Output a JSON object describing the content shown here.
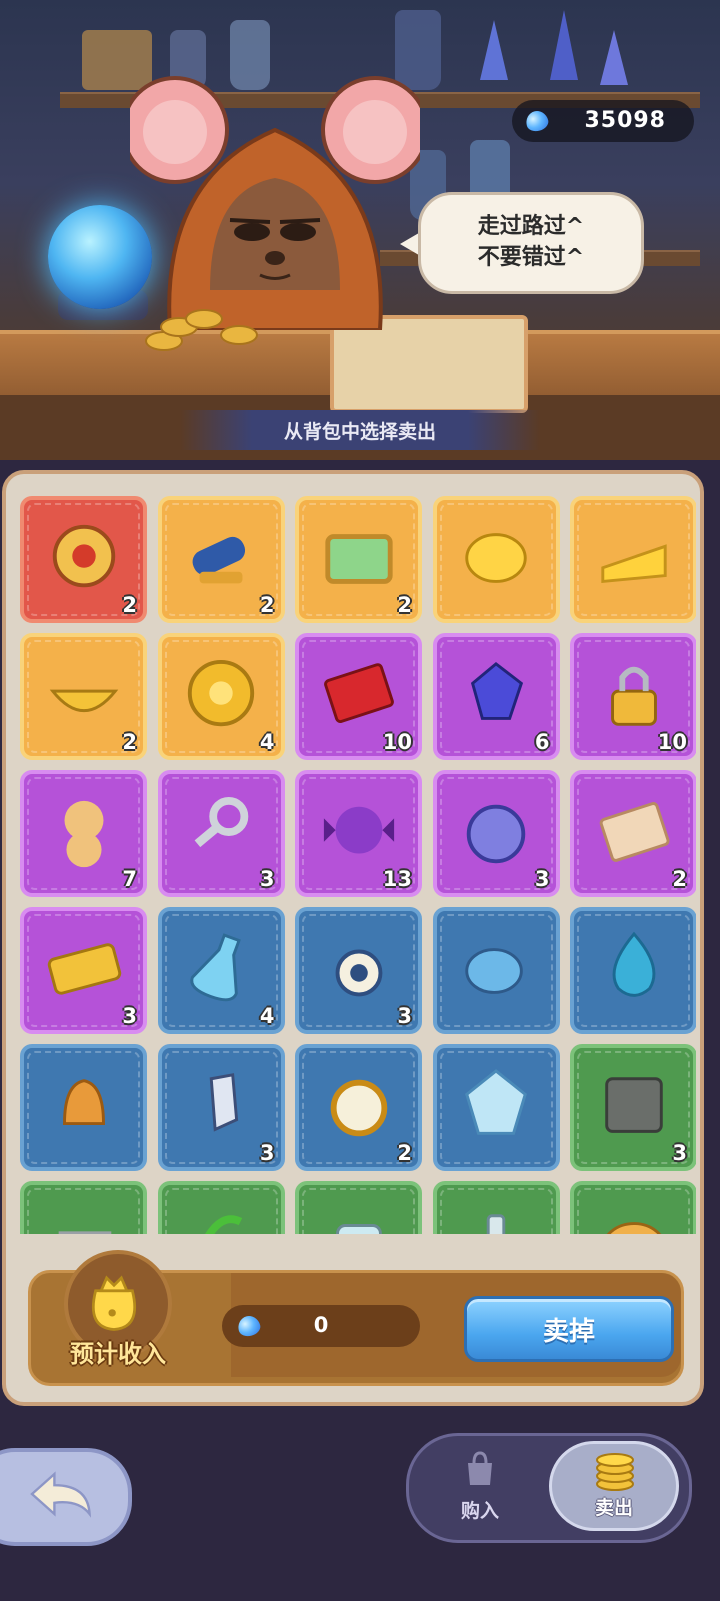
{
  "header": {
    "currency_value": "35098",
    "currency_icon": "blue-gem-icon",
    "speech_line1": "走过路过^",
    "speech_line2": "不要错过^",
    "banner": "从背包中选择卖出"
  },
  "inventory": [
    {
      "rarity": "red",
      "icon": "spinning-wheel-icon",
      "count": "2"
    },
    {
      "rarity": "gold",
      "icon": "cannon-icon",
      "count": "2"
    },
    {
      "rarity": "gold",
      "icon": "terrarium-icon",
      "count": "2"
    },
    {
      "rarity": "gold",
      "icon": "golden-sheep-icon",
      "count": ""
    },
    {
      "rarity": "gold",
      "icon": "cheese-icon",
      "count": ""
    },
    {
      "rarity": "gold",
      "icon": "golden-bowl-icon",
      "count": "2"
    },
    {
      "rarity": "gold",
      "icon": "clover-coin-icon",
      "count": "4"
    },
    {
      "rarity": "purple",
      "icon": "red-book-icon",
      "count": "10"
    },
    {
      "rarity": "purple",
      "icon": "gem-icon",
      "count": "6"
    },
    {
      "rarity": "purple",
      "icon": "padlock-icon",
      "count": "10"
    },
    {
      "rarity": "purple",
      "icon": "teddy-bear-icon",
      "count": "7"
    },
    {
      "rarity": "purple",
      "icon": "key-icon",
      "count": "3"
    },
    {
      "rarity": "purple",
      "icon": "candy-icon",
      "count": "13"
    },
    {
      "rarity": "purple",
      "icon": "stopwatch-icon",
      "count": "3"
    },
    {
      "rarity": "purple",
      "icon": "love-letter-icon",
      "count": "2"
    },
    {
      "rarity": "purple",
      "icon": "vip-ticket-icon",
      "count": "3"
    },
    {
      "rarity": "blue",
      "icon": "bottle-icon",
      "count": "4"
    },
    {
      "rarity": "blue",
      "icon": "amulet-icon",
      "count": "3"
    },
    {
      "rarity": "blue",
      "icon": "pufferfish-icon",
      "count": ""
    },
    {
      "rarity": "blue",
      "icon": "water-drop-icon",
      "count": ""
    },
    {
      "rarity": "blue",
      "icon": "bell-icon",
      "count": ""
    },
    {
      "rarity": "blue",
      "icon": "crystal-shard-icon",
      "count": "3"
    },
    {
      "rarity": "blue",
      "icon": "alarm-clock-icon",
      "count": "2"
    },
    {
      "rarity": "blue",
      "icon": "ice-crystal-icon",
      "count": ""
    },
    {
      "rarity": "green",
      "icon": "rune-tablet-icon",
      "count": "3"
    },
    {
      "rarity": "green",
      "icon": "dagger-icon",
      "count": ""
    },
    {
      "rarity": "green",
      "icon": "sprout-icon",
      "count": ""
    },
    {
      "rarity": "green",
      "icon": "jar-icon",
      "count": ""
    },
    {
      "rarity": "green",
      "icon": "potion-icon",
      "count": ""
    },
    {
      "rarity": "green",
      "icon": "bread-icon",
      "count": ""
    }
  ],
  "income": {
    "label": "预计收入",
    "value": "0"
  },
  "actions": {
    "sell_label": "卖掉",
    "buy_tab": "购入",
    "sell_tab": "卖出"
  },
  "colors": {
    "red": "#e2574a",
    "gold": "#f4b14a",
    "purple": "#b552d8",
    "blue": "#3f78b0",
    "green": "#4f9a4f"
  }
}
